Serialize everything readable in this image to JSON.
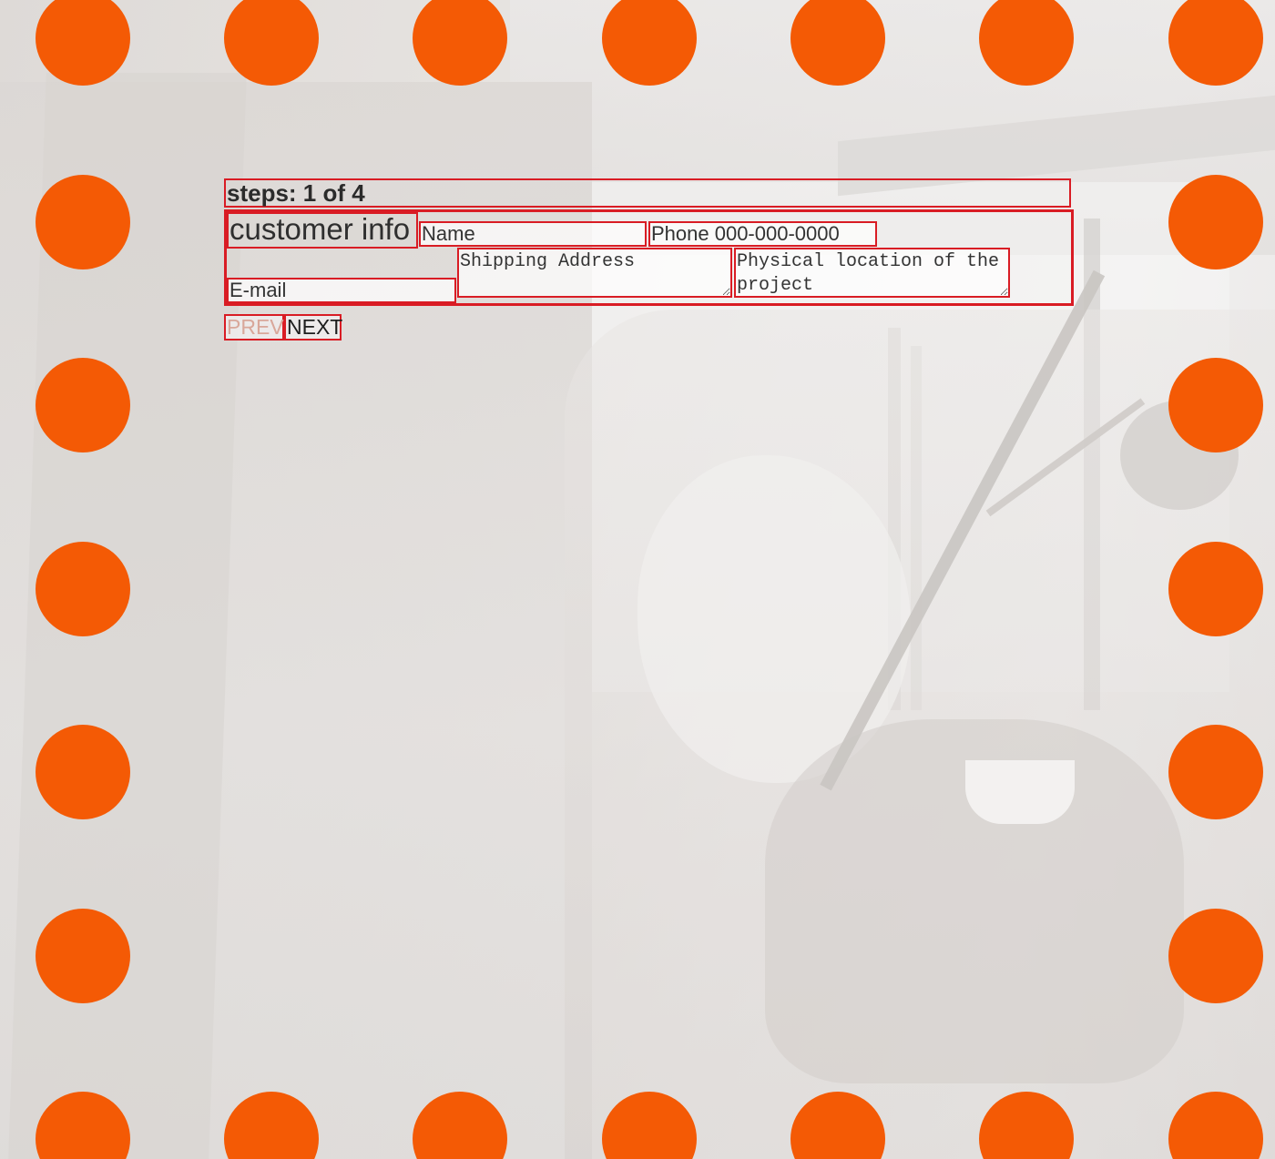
{
  "progress": {
    "label": "steps: 1 of 4",
    "current_step": 1,
    "total_steps": 4
  },
  "form": {
    "section_title": "customer info",
    "fields": {
      "name": {
        "value": "",
        "placeholder": "Name"
      },
      "phone": {
        "value": "",
        "placeholder": "Phone 000-000-0000"
      },
      "email": {
        "value": "",
        "placeholder": "E-mail"
      },
      "shipping_address": {
        "value": "",
        "placeholder": "Shipping Address"
      },
      "project_location": {
        "value": "",
        "placeholder": "Physical location of the project"
      }
    }
  },
  "nav": {
    "prev_label": "PREV",
    "next_label": "NEXT",
    "prev_disabled": true
  },
  "colors": {
    "accent_dot": "#f45a05",
    "border_red": "#d91c24"
  }
}
